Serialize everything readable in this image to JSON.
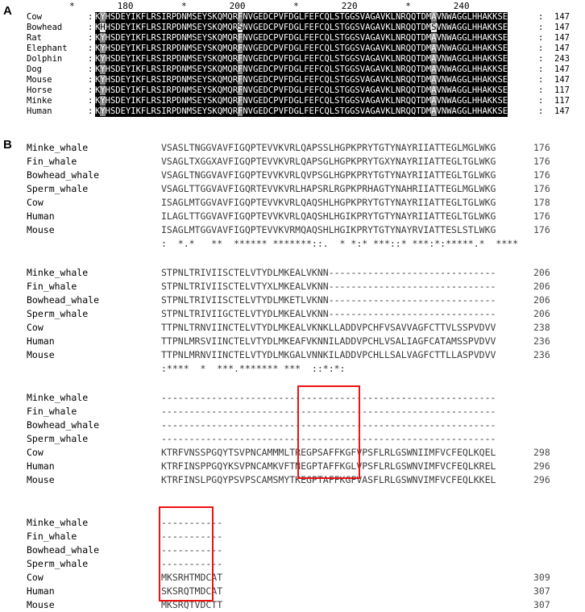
{
  "figure": {
    "panel_a_letter": "A",
    "panel_b_letter": "B"
  },
  "panel_a": {
    "ruler": "        *        180         *        200         *        220         *        240",
    "left_colon": ":",
    "right_colon": ":",
    "rows": [
      {
        "name": "Cow",
        "seq_pre": "K",
        "hl1": "Y",
        "hl1_type": "gray",
        "seq_mid1": "HSDEYIKFLRSIRPDNMSEYSKQMQR",
        "hl2": "F",
        "hl2_type": "gray",
        "seq_mid2": "NVGEDCPVFDGLFEFCQLSTGGSVAGAVKLNRQQTDM",
        "hl3": "A",
        "hl3_type": "gray",
        "seq_post": "VNWAGGLHHAKKSE",
        "count": "147"
      },
      {
        "name": "Bowhead",
        "seq_pre": "K",
        "hl1": "H",
        "hl1_type": "white",
        "seq_mid1": "HSDEYIKFLRSIRPDNMSEYSKQMQR",
        "hl2": "S",
        "hl2_type": "white",
        "seq_mid2": "NVGEDCPVFDGLFEFCQLSTGGSVAGAVKLNRQQTDM",
        "hl3": "S",
        "hl3_type": "white",
        "seq_post": "VNWAGGLHHAKKSE",
        "count": "147"
      },
      {
        "name": "Rat",
        "seq_pre": "K",
        "hl1": "Y",
        "hl1_type": "gray",
        "seq_mid1": "HSDEYIKFLRSIRPDNMSEYSKQMQR",
        "hl2": "F",
        "hl2_type": "gray",
        "seq_mid2": "NVGEDCPVFDGLFEFCQLSTGGSVAGAVKLNRQQTDM",
        "hl3": "A",
        "hl3_type": "gray",
        "seq_post": "VNWAGGLHHAKKSE",
        "count": "147"
      },
      {
        "name": "Elephant",
        "seq_pre": "K",
        "hl1": "Y",
        "hl1_type": "gray",
        "seq_mid1": "HSDEYIKFLRSIRPDNMSEYSKQMQR",
        "hl2": "F",
        "hl2_type": "gray",
        "seq_mid2": "NVGEDCPVFDGLFEFCQLSTGGSVAGAVKLNRQQTDM",
        "hl3": "A",
        "hl3_type": "gray",
        "seq_post": "VNWAGGLHHAKKSE",
        "count": "147"
      },
      {
        "name": "Dolphin",
        "seq_pre": "K",
        "hl1": "Y",
        "hl1_type": "gray",
        "seq_mid1": "HSDEYIKFLRSIRPDNMSEYSKQMQR",
        "hl2": "F",
        "hl2_type": "gray",
        "seq_mid2": "NVGEDCPVFDGLFEFCQLSTGGSVAGAVKLNRQQTDM",
        "hl3": "A",
        "hl3_type": "gray",
        "seq_post": "VNWAGGLHHAKKSE",
        "count": "243"
      },
      {
        "name": "Dog",
        "seq_pre": "K",
        "hl1": "Y",
        "hl1_type": "gray",
        "seq_mid1": "HSDEYIKFLRSIRPDNMSEYSKQMQR",
        "hl2": "F",
        "hl2_type": "gray",
        "seq_mid2": "NVGEDCPVFDGLFEFCQLSTGGSVAGAVKLNRQQTDM",
        "hl3": "A",
        "hl3_type": "gray",
        "seq_post": "VNWAGGLHHAKKSE",
        "count": "147"
      },
      {
        "name": "Mouse",
        "seq_pre": "K",
        "hl1": "Y",
        "hl1_type": "gray",
        "seq_mid1": "HSDEYIKFLRSIRPDNMSEYSKQMQR",
        "hl2": "F",
        "hl2_type": "gray",
        "seq_mid2": "NVGEDCPVFDGLFEFCQLSTGGSVAGAVKLNRQQTDM",
        "hl3": "A",
        "hl3_type": "gray",
        "seq_post": "VNWAGGLHHAKKSE",
        "count": "147"
      },
      {
        "name": "Horse",
        "seq_pre": "K",
        "hl1": "Y",
        "hl1_type": "gray",
        "seq_mid1": "HSDEYIKFLRSIRPDNMSEYSKQMQR",
        "hl2": "F",
        "hl2_type": "gray",
        "seq_mid2": "NVGEDCPVFDGLFEFCQLSTGGSVAGAVKLNRQQTDM",
        "hl3": "A",
        "hl3_type": "gray",
        "seq_post": "VNWAGGLHHAKKSE",
        "count": "117"
      },
      {
        "name": "Minke",
        "seq_pre": "K",
        "hl1": "Y",
        "hl1_type": "gray",
        "seq_mid1": "HSDEYIKFLRSIRPDNMSEYSKQMQR",
        "hl2": "F",
        "hl2_type": "gray",
        "seq_mid2": "NVGEDCPVFDGLFEFCQLSTGGSVAGAVKLNRQQTDM",
        "hl3": "A",
        "hl3_type": "gray",
        "seq_post": "VNWAGGLHHAKKSE",
        "count": "117"
      },
      {
        "name": "Human",
        "seq_pre": "K",
        "hl1": "Y",
        "hl1_type": "gray",
        "seq_mid1": "HSDEYIKFLRSIRPDNMSEYSKQMQR",
        "hl2": "F",
        "hl2_type": "gray",
        "seq_mid2": "NVGEDCPVFDGLFEFCQLSTGGSVAGAVKLNRQQTDM",
        "hl3": "A",
        "hl3_type": "gray",
        "seq_post": "VNWAGGLHHAKKSE",
        "count": "147"
      }
    ]
  },
  "panel_b": {
    "blocks": [
      {
        "rows": [
          {
            "name": "Minke_whale",
            "seq": "VSASLTNGGVAVFIGQPTEVVKVRLQAPSSLHGPKPRYTGTYNAYRIIATTEGLMGLWKG",
            "count": "176"
          },
          {
            "name": "Fin_whale",
            "seq": "VSAGLTXGGXAVFIGQPTEVVKVRLQAPSGLHGPKPRYTGXYNAYRIIATTEGLTGLWKG",
            "count": "176"
          },
          {
            "name": "Bowhead_whale",
            "seq": "VSAGLTNGGVAVFIGQPTEVVKVRLQVPSGLHGPKPRYTGTYNAYRIIATTEGLTGLWKG",
            "count": "176"
          },
          {
            "name": "Sperm_whale",
            "seq": "VSAGLTTGGVAVFIGQRTEVVKVRLHAPSRLRGPKPRHAGTYNAHRIIATTEGLMGLWKG",
            "count": "176"
          },
          {
            "name": "Cow",
            "seq": "ISAGLMTGGVAVFIGQPTEVVKVRLQAQSHLHGPKPRYTGTYNAYRIIATTEGLTGLWKG",
            "count": "178"
          },
          {
            "name": "Human",
            "seq": "ILAGLTTGGVAVFIGQPTEVVKVRLQAQSHLHGIKPRYTGTYNAYRIIATTEGLTGLWKG",
            "count": "176"
          },
          {
            "name": "Mouse",
            "seq": "ISAGLMTGGVAVFIGQPTEVVKVRMQAQSHLHGIKPRYTGTYNAYRVIATTESLSTLWKG",
            "count": "176"
          }
        ],
        "consensus": ":  *.*   **  ****** *******::.  * *:* ***::* ***:*:*****.*  ****"
      },
      {
        "rows": [
          {
            "name": "Minke_whale",
            "seq": "STPNLTRIVIISCTELVTYDLMKEALVKNN------------------------------",
            "count": "206"
          },
          {
            "name": "Fin_whale",
            "seq": "STPNLTRIVIISCTELVTYXLMKEALVKNN------------------------------",
            "count": "206"
          },
          {
            "name": "Bowhead_whale",
            "seq": "STPNLTRIVIISCTELVTYDLMKETLVKNN------------------------------",
            "count": "206"
          },
          {
            "name": "Sperm_whale",
            "seq": "STPNLTRIVIIGCTELVTYDLMKEALVKNN------------------------------",
            "count": "206"
          },
          {
            "name": "Cow",
            "seq": "TTPNLTRNVIINCTELVTYDLMKEALVKNKLLADDVPCHFVSAVVAGFCTTVLSSPVDVV",
            "count": "238"
          },
          {
            "name": "Human",
            "seq": "TTPNLMRSVIINCTELVTYDLMKEAFVKNNILADDVPCHLVSALIAGFCATAMSSPVDVV",
            "count": "236"
          },
          {
            "name": "Mouse",
            "seq": "TTPNLMRNVIINCTELVTYDLMKGALVNNKILADDVPCHLLSALVAGFCTTLLASPVDVV",
            "count": "236"
          }
        ],
        "consensus": ":****  *  ***.******* ***  ::*:*:"
      },
      {
        "rows": [
          {
            "name": "Minke_whale",
            "seq": "------------------------------------------------------------",
            "count": ""
          },
          {
            "name": "Fin_whale",
            "seq": "------------------------------------------------------------",
            "count": ""
          },
          {
            "name": "Bowhead_whale",
            "seq": "------------------------------------------------------------",
            "count": ""
          },
          {
            "name": "Sperm_whale",
            "seq": "------------------------------------------------------------",
            "count": ""
          },
          {
            "name": "Cow",
            "seq": "KTRFVNSSPGQYTSVPNCAMMMLTREGPSAFFKGFVPSFLRLGSWNIIMFVCFEQLKQEL",
            "count": "298"
          },
          {
            "name": "Human",
            "seq": "KTRFINSPPGQYKSVPNCAMKVFTNEGPTAFFKGLVPSFLRLGSWNVIMFVCFEQLKREL",
            "count": "296"
          },
          {
            "name": "Mouse",
            "seq": "KTRFINSLPGQYPSVPSCAMSMYTKEGPTAFFKGFVASFLRLGSWNVIMFVCFEQLKKEL",
            "count": "296"
          }
        ],
        "consensus": ""
      },
      {
        "rows": [
          {
            "name": "Minke_whale",
            "seq": "-----------",
            "count": ""
          },
          {
            "name": "Fin_whale",
            "seq": "-----------",
            "count": ""
          },
          {
            "name": "Bowhead_whale",
            "seq": "-----------",
            "count": ""
          },
          {
            "name": "Sperm_whale",
            "seq": "-----------",
            "count": ""
          },
          {
            "name": "Cow",
            "seq": "MKSRHTMDCAT",
            "count": "309"
          },
          {
            "name": "Human",
            "seq": "SKSRQTMDCAT",
            "count": "307"
          },
          {
            "name": "Mouse",
            "seq": "MKSRQTVDCTT",
            "count": "307"
          }
        ],
        "consensus": ""
      }
    ]
  },
  "annotations": {
    "red_box_color": "#ee1111",
    "boxes": [
      {
        "name": "motif-box-gptaffkg",
        "block": 3,
        "label": "GPSAFFKGF / GPTAFFKGL / GPTAFFKGF"
      },
      {
        "name": "motif-box-htmdcat",
        "block": 4,
        "label": "HTMDCAT / QTMDCAT / QTVDCTT"
      }
    ]
  }
}
